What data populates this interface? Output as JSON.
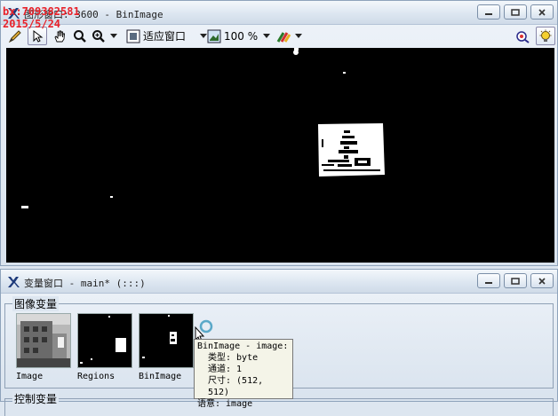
{
  "watermark": {
    "line1": "bx:709382581",
    "line2": "2015/5/24"
  },
  "graphics_window": {
    "title": "图形窗口: 3600 - BinImage",
    "fit_label": "适应窗口",
    "zoom_label": "100 %"
  },
  "variables_window": {
    "title": "变量窗口 - main* (:::)",
    "image_group_label": "图像变量",
    "control_group_label": "控制变量",
    "images": [
      {
        "name": "Image"
      },
      {
        "name": "Regions"
      },
      {
        "name": "BinImage"
      }
    ]
  },
  "tooltip": {
    "header": "BinImage - image:",
    "type_line": "类型: byte",
    "channels_line": "通道: 1",
    "size_line": "尺寸: (512, 512)",
    "semantics_line": "语意: image"
  },
  "colors": {
    "accent": "#e8222a",
    "canvas": "#000000"
  }
}
